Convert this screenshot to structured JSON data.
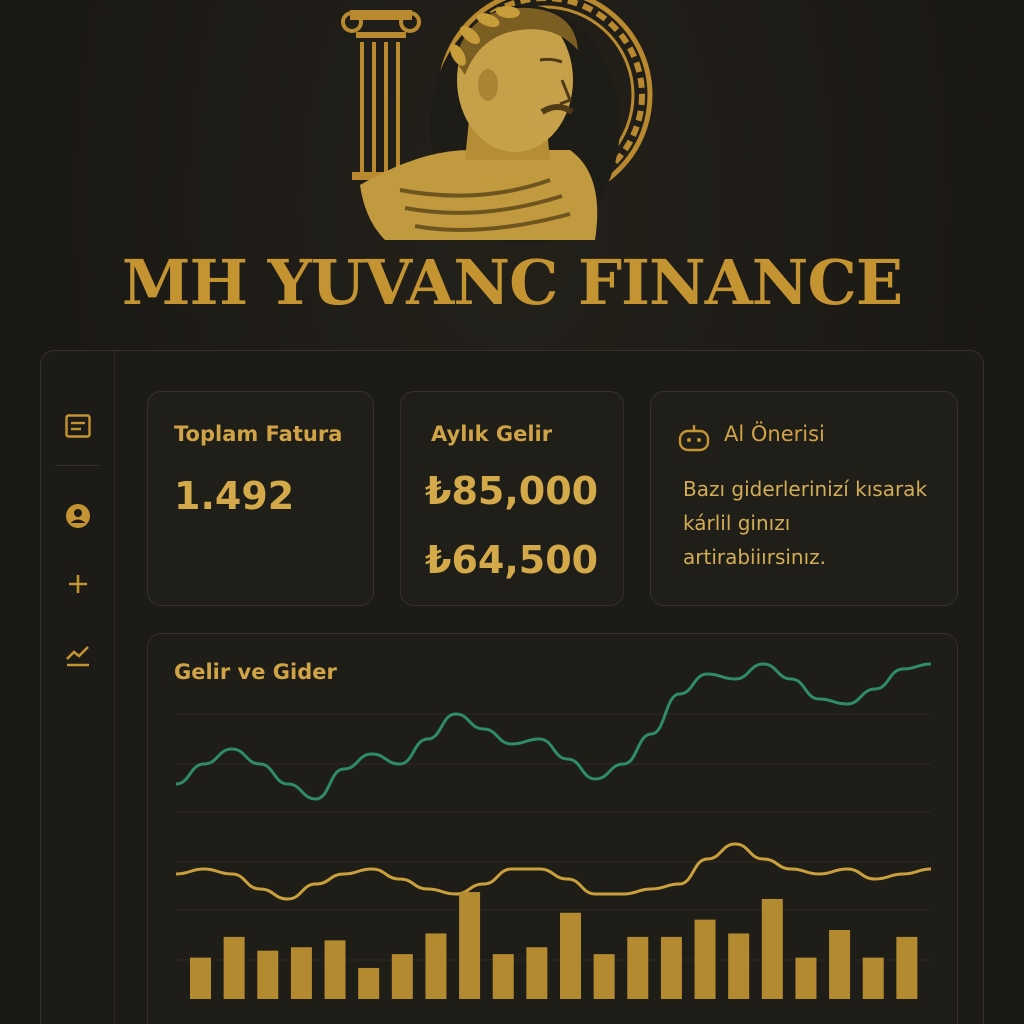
{
  "brand": {
    "title": "MH YUVANC FINANCE",
    "logo_icon": "roman-bust-logo-icon"
  },
  "sidebar": {
    "items": [
      {
        "icon": "document-icon",
        "name": "sidebar-item-invoices"
      },
      {
        "icon": "user-icon",
        "name": "sidebar-item-profile"
      },
      {
        "icon": "plus-icon",
        "name": "sidebar-item-add"
      },
      {
        "icon": "trend-chart-icon",
        "name": "sidebar-item-reports"
      }
    ]
  },
  "cards": {
    "invoices": {
      "label": "Toplam Fatura",
      "value": "1.492"
    },
    "income": {
      "label": "Aylık Gelir",
      "value_primary": "₺85,000",
      "value_secondary": "₺64,500"
    },
    "ai": {
      "label": "Al Önerisi",
      "text": "Bazı giderlerinizí kısarak kárlil ginızı artirabiiırsinız.",
      "icon": "robot-icon"
    }
  },
  "colors": {
    "gold": "#c9a03c",
    "green": "#2e8c6a",
    "background": "#1c1a16"
  },
  "chart_data": {
    "type": "line",
    "title": "Gelir ve Gider",
    "xlabel": "",
    "ylabel": "",
    "grid": true,
    "series": [
      {
        "values": [
          62,
          66,
          69,
          66,
          62,
          59,
          65,
          68,
          66,
          71,
          76,
          73,
          70,
          71,
          67,
          63,
          66,
          72,
          80,
          84,
          83,
          86,
          83,
          79,
          78,
          81,
          85,
          86
        ]
      },
      {
        "values": [
          44,
          45,
          44,
          41,
          39,
          42,
          44,
          45,
          43,
          41,
          40,
          42,
          45,
          45,
          43,
          40,
          40,
          41,
          42,
          47,
          50,
          47,
          45,
          44,
          45,
          43,
          44,
          45
        ]
      }
    ],
    "bars": [
      12,
      18,
      14,
      15,
      17,
      9,
      13,
      19,
      31,
      13,
      15,
      25,
      13,
      18,
      18,
      23,
      19,
      29,
      12,
      20,
      12,
      18
    ]
  }
}
